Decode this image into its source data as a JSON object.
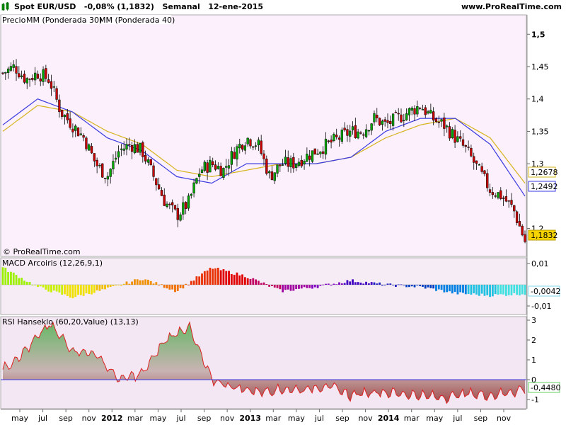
{
  "header": {
    "title": "Spot EUR/USD",
    "change": "-0,08% (1,1832)",
    "period": "Semanal",
    "date": "12-ene-2015",
    "site": "www.ProRealTime.com"
  },
  "price_panel": {
    "legend": [
      "Precio",
      "MM (Ponderada 30)",
      "MM (Ponderada 40)"
    ],
    "copyright": "© ProRealTime.com",
    "y_ticks": [
      "1,5",
      "1,45",
      "1,4",
      "1,35",
      "1,3",
      "1,2"
    ],
    "labels": {
      "ma40": "1,2678",
      "ma30": "1,2492",
      "price": "1,1832"
    }
  },
  "macd_panel": {
    "legend": "MACD Arcoiris (12,26,9,1)",
    "y_ticks": [
      "0,01",
      "-0,01"
    ],
    "label": "-0,0042"
  },
  "rsi_panel": {
    "legend": "RSI Hanseklo (60,20,Value) (13,13)",
    "y_ticks": [
      "3",
      "2",
      "1",
      "0",
      "-1"
    ],
    "label": "-0,4480"
  },
  "x_axis": {
    "ticks": [
      "may",
      "jul",
      "sep",
      "nov",
      "2012",
      "mar",
      "may",
      "jul",
      "sep",
      "nov",
      "2013",
      "mar",
      "may",
      "jul",
      "sep",
      "nov",
      "2014",
      "mar",
      "may",
      "jul",
      "sep",
      "nov"
    ]
  },
  "colors": {
    "up": "#00aa00",
    "down": "#cc0000",
    "ma30": "#3a3ae0",
    "ma40": "#d6b41e",
    "bg_price": "#fbf0fb",
    "bg_macd": "#f6ecf6",
    "bg_rsi": "#f3e7f3"
  },
  "chart_data": [
    {
      "type": "candlestick",
      "title": "Spot EUR/USD",
      "series": [
        {
          "name": "Precio",
          "x": [
            "2011-04",
            "2011-05",
            "2011-06",
            "2011-07",
            "2011-08",
            "2011-09",
            "2011-10",
            "2011-11",
            "2011-12",
            "2012-01",
            "2012-02",
            "2012-03",
            "2012-04",
            "2012-05",
            "2012-06",
            "2012-07",
            "2012-08",
            "2012-09",
            "2012-10",
            "2012-11",
            "2012-12",
            "2013-01",
            "2013-02",
            "2013-03",
            "2013-04",
            "2013-05",
            "2013-06",
            "2013-07",
            "2013-08",
            "2013-09",
            "2013-10",
            "2013-11",
            "2013-12",
            "2014-01",
            "2014-02",
            "2014-03",
            "2014-04",
            "2014-05",
            "2014-06",
            "2014-07",
            "2014-08",
            "2014-09",
            "2014-10",
            "2014-11",
            "2014-12",
            "2015-01"
          ],
          "y": [
            1.44,
            1.45,
            1.43,
            1.44,
            1.43,
            1.38,
            1.36,
            1.34,
            1.3,
            1.28,
            1.32,
            1.33,
            1.32,
            1.28,
            1.24,
            1.22,
            1.24,
            1.29,
            1.3,
            1.29,
            1.32,
            1.34,
            1.33,
            1.28,
            1.3,
            1.3,
            1.31,
            1.32,
            1.33,
            1.34,
            1.35,
            1.35,
            1.37,
            1.36,
            1.37,
            1.38,
            1.39,
            1.37,
            1.36,
            1.34,
            1.32,
            1.29,
            1.26,
            1.25,
            1.23,
            1.18
          ]
        },
        {
          "name": "MM (Ponderada 30)",
          "x": [
            "2011-04",
            "2011-07",
            "2011-10",
            "2012-01",
            "2012-04",
            "2012-07",
            "2012-10",
            "2013-01",
            "2013-04",
            "2013-07",
            "2013-10",
            "2014-01",
            "2014-04",
            "2014-07",
            "2014-10",
            "2015-01"
          ],
          "y": [
            1.36,
            1.4,
            1.38,
            1.34,
            1.32,
            1.28,
            1.27,
            1.3,
            1.3,
            1.3,
            1.31,
            1.35,
            1.37,
            1.37,
            1.33,
            1.25
          ]
        },
        {
          "name": "MM (Ponderada 40)",
          "x": [
            "2011-04",
            "2011-07",
            "2011-10",
            "2012-01",
            "2012-04",
            "2012-07",
            "2012-10",
            "2013-01",
            "2013-04",
            "2013-07",
            "2013-10",
            "2014-01",
            "2014-04",
            "2014-07",
            "2014-10",
            "2015-01"
          ],
          "y": [
            1.35,
            1.39,
            1.38,
            1.35,
            1.33,
            1.29,
            1.28,
            1.29,
            1.3,
            1.3,
            1.31,
            1.34,
            1.36,
            1.37,
            1.34,
            1.27
          ]
        }
      ],
      "ylim": [
        1.17,
        1.52
      ],
      "last_price": 1.1832,
      "ma30_last": 1.2492,
      "ma40_last": 1.2678
    },
    {
      "type": "bar",
      "title": "MACD Arcoiris (12,26,9,1)",
      "x": [
        "2011-04",
        "2011-07",
        "2011-10",
        "2012-01",
        "2012-04",
        "2012-07",
        "2012-10",
        "2013-01",
        "2013-04",
        "2013-07",
        "2013-10",
        "2014-01",
        "2014-04",
        "2014-07",
        "2014-10",
        "2015-01"
      ],
      "values": [
        0.008,
        -0.001,
        -0.006,
        -0.002,
        0.003,
        -0.003,
        0.008,
        0.004,
        -0.003,
        -0.001,
        0.002,
        0.0,
        -0.001,
        -0.004,
        -0.005,
        -0.0042
      ],
      "ylim": [
        -0.016,
        0.014
      ]
    },
    {
      "type": "area",
      "title": "RSI Hanseklo (60,20,Value) (13,13)",
      "x": [
        "2011-04",
        "2011-06",
        "2011-08",
        "2011-10",
        "2011-12",
        "2012-02",
        "2012-04",
        "2012-06",
        "2012-08",
        "2012-10",
        "2012-12",
        "2013-02",
        "2013-04",
        "2013-06",
        "2013-08",
        "2013-10",
        "2013-12",
        "2014-02",
        "2014-04",
        "2014-06",
        "2014-08",
        "2014-10",
        "2014-12",
        "2015-01"
      ],
      "values": [
        0.5,
        1.5,
        2.8,
        1.5,
        1.3,
        0.0,
        0.3,
        2.0,
        2.7,
        0.0,
        -0.4,
        -0.6,
        -0.5,
        -0.5,
        -0.3,
        -0.8,
        -0.6,
        -0.7,
        -0.8,
        -0.9,
        -0.7,
        -0.8,
        -0.6,
        -0.448
      ],
      "ylim": [
        -1.4,
        3.2
      ]
    }
  ]
}
